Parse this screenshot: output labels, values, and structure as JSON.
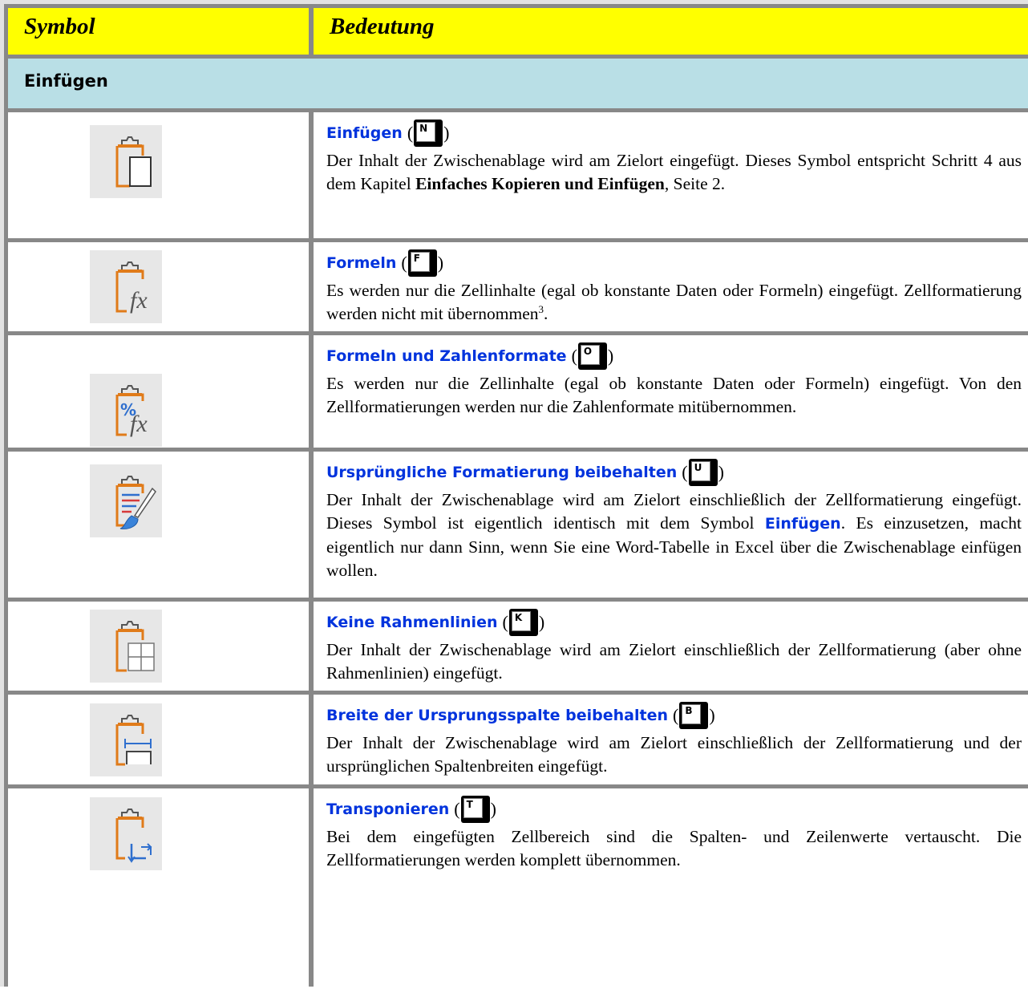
{
  "table": {
    "header": {
      "col_symbol": "Symbol",
      "col_meaning": "Bedeutung"
    },
    "section": "Einfügen",
    "rows": [
      {
        "icon": "paste-icon",
        "title": "Einfügen",
        "key": "N",
        "text_before": "Der Inhalt der Zwischenablage wird am Zielort eingefügt. Dieses Symbol entspricht Schritt 4 aus dem Kapitel ",
        "text_bold": "Einfaches Kopieren und Einfügen",
        "text_after": ", Seite 2."
      },
      {
        "icon": "paste-formulas-icon",
        "title": "Formeln",
        "key": "F",
        "text_before": "Es werden nur die Zellinhalte (egal ob konstante Daten oder Formeln) eingefügt. Zellformatierung werden nicht mit übernommen",
        "footnote": "3",
        "text_after": "."
      },
      {
        "icon": "paste-formulas-number-formats-icon",
        "title": "Formeln und Zahlenformate",
        "key": "O",
        "text": "Es werden nur die Zellinhalte (egal ob konstante Daten oder Formeln) eingefügt. Von den Zellformatierungen werden nur die Zahlenformate mitübernommen."
      },
      {
        "icon": "paste-keep-source-formatting-icon",
        "title": "Ursprüngliche Formatierung beibehalten",
        "key": "U",
        "text_before": "Der Inhalt der Zwischenablage wird am Zielort einschließlich der Zellformatierung eingefügt. Dieses Symbol ist eigentlich identisch mit dem Symbol ",
        "text_ref": "Einfügen",
        "text_after": ". Es einzusetzen, macht eigentlich nur dann Sinn, wenn Sie eine Word-Tabelle in Excel über die Zwischenablage einfügen wollen."
      },
      {
        "icon": "paste-no-borders-icon",
        "title": "Keine Rahmenlinien",
        "key": "K",
        "text": "Der Inhalt der Zwischenablage wird am Zielort einschließlich der Zellformatierung (aber ohne Rahmenlinien) eingefügt."
      },
      {
        "icon": "paste-keep-column-widths-icon",
        "title": "Breite der Ursprungsspalte beibehalten",
        "key": "B",
        "text": "Der Inhalt der Zwischenablage wird am Zielort einschließlich der Zellformatierung und der ursprünglichen Spaltenbreiten eingefügt."
      },
      {
        "icon": "paste-transpose-icon",
        "title": "Transponieren",
        "key": "T",
        "text": "Bei dem eingefügten Zellbereich sind die Spalten- und Zeilenwerte vertauscht. Die Zellformatierungen werden komplett übernommen."
      }
    ],
    "paren_open": "(",
    "paren_close": ")"
  },
  "colors": {
    "header": "#ffff00",
    "section": "#b9dfe6",
    "link": "#0033dd",
    "icon_orange": "#e07b1a",
    "icon_bg": "#e7e7e7"
  }
}
